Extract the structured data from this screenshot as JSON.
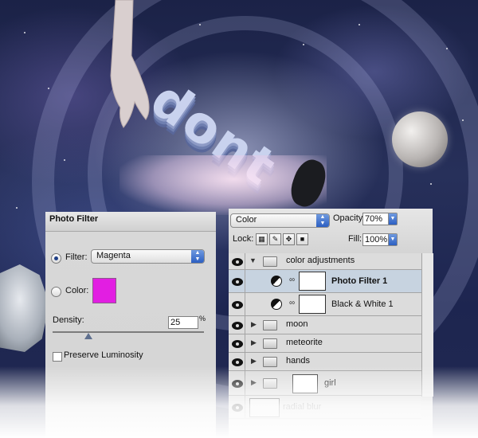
{
  "colors": {
    "filter_swatch": "#e21ee2",
    "selected_row": "#c7d3e0"
  },
  "photo_filter": {
    "title": "Photo Filter",
    "filter_label": "Filter:",
    "filter_value": "Magenta",
    "color_label": "Color:",
    "density_label": "Density:",
    "density_value": "25",
    "density_unit": "%",
    "preserve_label": "Preserve Luminosity"
  },
  "layers": {
    "blend_mode": "Color",
    "opacity_label": "Opacity:",
    "opacity_value": "70%",
    "lock_label": "Lock:",
    "fill_label": "Fill:",
    "fill_value": "100%",
    "rows": [
      {
        "name": "color adjustments"
      },
      {
        "name": "Photo Filter 1"
      },
      {
        "name": "Black & White 1"
      },
      {
        "name": "moon"
      },
      {
        "name": "meteorite"
      },
      {
        "name": "hands"
      },
      {
        "name": "girl"
      },
      {
        "name": "radial blur"
      }
    ]
  },
  "artwork": {
    "headline": "dont"
  }
}
